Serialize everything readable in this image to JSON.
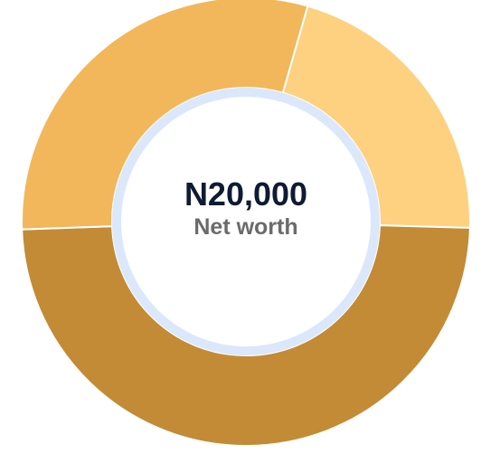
{
  "chart_data": {
    "type": "donut",
    "series": [
      {
        "value": 21,
        "color": "#fdd17f"
      },
      {
        "value": 49,
        "color": "#c38b35"
      },
      {
        "value": 30,
        "color": "#f2b75a"
      }
    ],
    "center_value": "N20,000",
    "center_label": "Net worth",
    "ring_inner_color": "#dbe7fb"
  }
}
